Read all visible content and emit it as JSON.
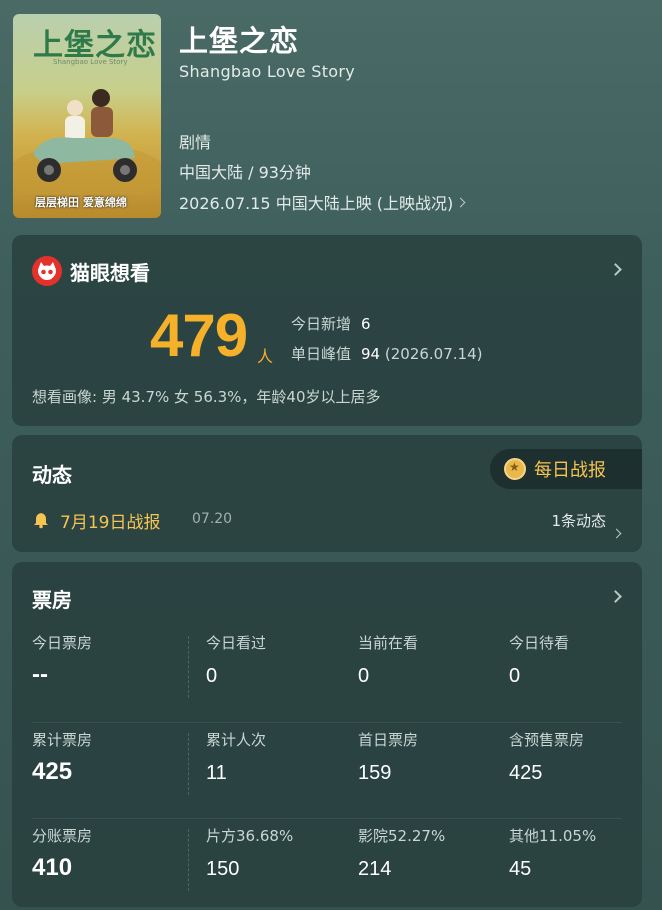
{
  "movie": {
    "poster": {
      "title_art": "上堡之恋",
      "subtitle_art": "Shangbao Love Story",
      "tagline_art": "层层梯田 爱意绵绵"
    },
    "title": "上堡之恋",
    "subtitle": "Shangbao Love Story",
    "genre": "剧情",
    "origin_duration": "中国大陆 / 93分钟",
    "release": "2026.07.15 中国大陆上映 (上映战况)"
  },
  "want": {
    "title": "猫眼想看",
    "count": "479",
    "unit": "人",
    "today_new_label": "今日新增",
    "today_new_value": "6",
    "peak_label": "单日峰值",
    "peak_value": "94",
    "peak_date": "(2026.07.14)",
    "portrait": "想看画像: 男 43.7%  女 56.3%，年龄40岁以上居多"
  },
  "news": {
    "title": "动态",
    "daily_label": "每日战报",
    "report_label": "7月19日战报",
    "report_date": "07.20",
    "count_label": "1条动态"
  },
  "boxoffice": {
    "title": "票房",
    "rows": [
      [
        {
          "label": "今日票房",
          "value": "--"
        },
        {
          "label": "今日看过",
          "value": "0"
        },
        {
          "label": "当前在看",
          "value": "0"
        },
        {
          "label": "今日待看",
          "value": "0"
        }
      ],
      [
        {
          "label": "累计票房",
          "value": "425"
        },
        {
          "label": "累计人次",
          "value": "11"
        },
        {
          "label": "首日票房",
          "value": "159"
        },
        {
          "label": "含预售票房",
          "value": "425"
        }
      ],
      [
        {
          "label": "分账票房",
          "value": "410"
        },
        {
          "label": "片方36.68%",
          "value": "150"
        },
        {
          "label": "影院52.27%",
          "value": "214"
        },
        {
          "label": "其他11.05%",
          "value": "45"
        }
      ]
    ]
  },
  "colors": {
    "accent_gold": "#f5b12a",
    "brand_red": "#e5312b"
  }
}
